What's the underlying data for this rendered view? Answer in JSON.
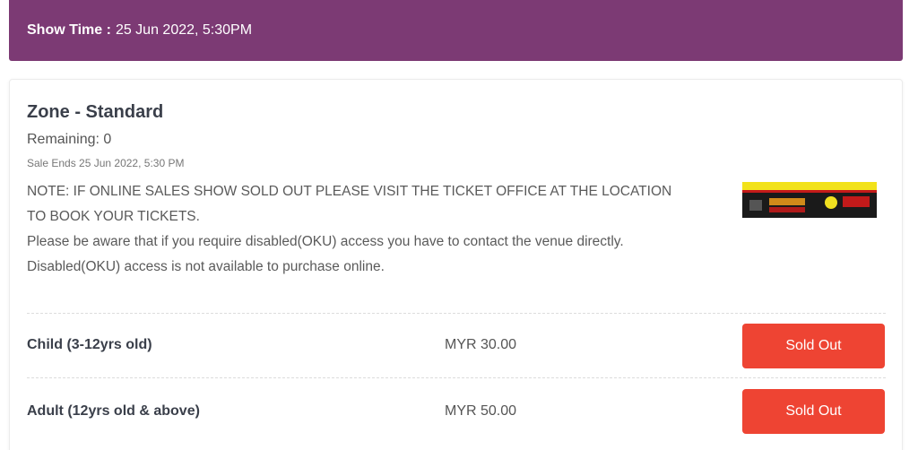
{
  "show": {
    "label": "Show Time :",
    "value": "25 Jun 2022, 5:30PM"
  },
  "zone": {
    "title": "Zone - Standard",
    "remaining": "Remaining: 0",
    "sale_ends": "Sale Ends 25 Jun 2022, 5:30 PM",
    "note_lines": [
      "NOTE: IF ONLINE SALES SHOW SOLD OUT PLEASE VISIT THE TICKET OFFICE AT THE LOCATION TO BOOK YOUR TICKETS.",
      "Please be aware that if you require disabled(OKU) access you have to contact the venue directly.",
      "Disabled(OKU) access is not available to purchase online."
    ]
  },
  "tickets": [
    {
      "name": "Child (3-12yrs old)",
      "price": "MYR 30.00",
      "button": "Sold Out"
    },
    {
      "name": "Adult (12yrs old & above)",
      "price": "MYR 50.00",
      "button": "Sold Out"
    }
  ],
  "colors": {
    "header_bg": "#7c3a74",
    "sold_out": "#ee4433"
  }
}
